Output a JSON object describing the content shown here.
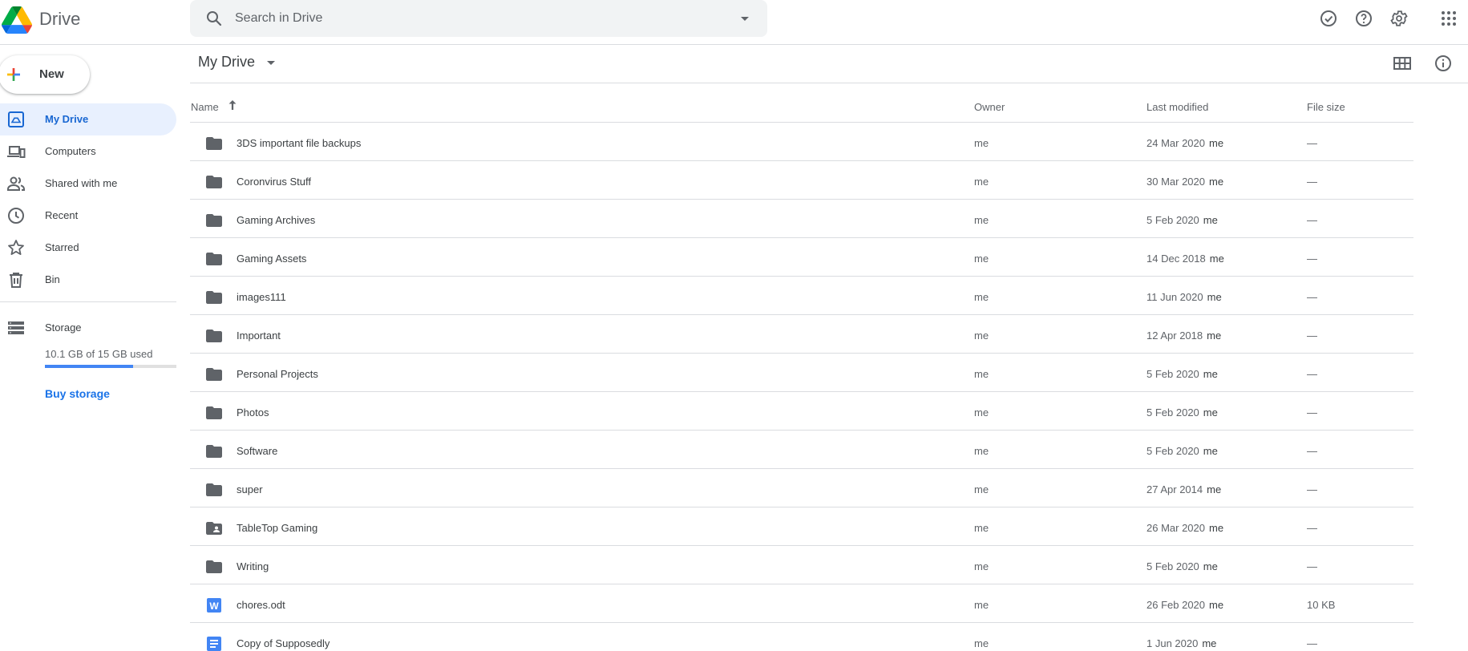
{
  "app": {
    "title": "Drive"
  },
  "search": {
    "placeholder": "Search in Drive",
    "value": ""
  },
  "header_icons": [
    "offline-ready-icon",
    "help-icon",
    "settings-icon",
    "apps-grid-icon"
  ],
  "sidebar": {
    "new_label": "New",
    "items": [
      {
        "label": "My Drive",
        "icon": "my-drive-icon",
        "active": true
      },
      {
        "label": "Computers",
        "icon": "computers-icon",
        "active": false
      },
      {
        "label": "Shared with me",
        "icon": "shared-icon",
        "active": false
      },
      {
        "label": "Recent",
        "icon": "clock-icon",
        "active": false
      },
      {
        "label": "Starred",
        "icon": "star-icon",
        "active": false
      },
      {
        "label": "Bin",
        "icon": "trash-icon",
        "active": false
      }
    ],
    "storage": {
      "label": "Storage",
      "usage_text": "10.1 GB of 15 GB used",
      "used_fraction": 0.673,
      "buy_label": "Buy storage"
    }
  },
  "main": {
    "title": "My Drive",
    "columns": {
      "name": "Name",
      "owner": "Owner",
      "modified": "Last modified",
      "size": "File size"
    },
    "sort": {
      "column": "name",
      "direction": "ascending"
    },
    "files": [
      {
        "name": "3DS important file backups",
        "type": "folder",
        "owner": "me",
        "modified": "24 Mar 2020",
        "modified_by": "me",
        "size": "—"
      },
      {
        "name": "Coronvirus Stuff",
        "type": "folder",
        "owner": "me",
        "modified": "30 Mar 2020",
        "modified_by": "me",
        "size": "—"
      },
      {
        "name": "Gaming Archives",
        "type": "folder",
        "owner": "me",
        "modified": "5 Feb 2020",
        "modified_by": "me",
        "size": "—"
      },
      {
        "name": "Gaming Assets",
        "type": "folder",
        "owner": "me",
        "modified": "14 Dec 2018",
        "modified_by": "me",
        "size": "—"
      },
      {
        "name": "images111",
        "type": "folder",
        "owner": "me",
        "modified": "11 Jun 2020",
        "modified_by": "me",
        "size": "—"
      },
      {
        "name": "Important",
        "type": "folder",
        "owner": "me",
        "modified": "12 Apr 2018",
        "modified_by": "me",
        "size": "—"
      },
      {
        "name": "Personal Projects",
        "type": "folder",
        "owner": "me",
        "modified": "5 Feb 2020",
        "modified_by": "me",
        "size": "—"
      },
      {
        "name": "Photos",
        "type": "folder",
        "owner": "me",
        "modified": "5 Feb 2020",
        "modified_by": "me",
        "size": "—"
      },
      {
        "name": "Software",
        "type": "folder",
        "owner": "me",
        "modified": "5 Feb 2020",
        "modified_by": "me",
        "size": "—"
      },
      {
        "name": "super",
        "type": "folder",
        "owner": "me",
        "modified": "27 Apr 2014",
        "modified_by": "me",
        "size": "—"
      },
      {
        "name": "TableTop Gaming",
        "type": "shared-folder",
        "owner": "me",
        "modified": "26 Mar 2020",
        "modified_by": "me",
        "size": "—"
      },
      {
        "name": "Writing",
        "type": "folder",
        "owner": "me",
        "modified": "5 Feb 2020",
        "modified_by": "me",
        "size": "—"
      },
      {
        "name": "chores.odt",
        "type": "word-doc",
        "owner": "me",
        "modified": "26 Feb 2020",
        "modified_by": "me",
        "size": "10 KB"
      },
      {
        "name": "Copy of Supposedly",
        "type": "google-doc",
        "owner": "me",
        "modified": "1 Jun 2020",
        "modified_by": "me",
        "size": "—"
      }
    ]
  },
  "colors": {
    "accent": "#1a73e8",
    "active_bg": "#e8f0fe",
    "folder": "#5f6368",
    "doc_blue": "#4285f4"
  }
}
